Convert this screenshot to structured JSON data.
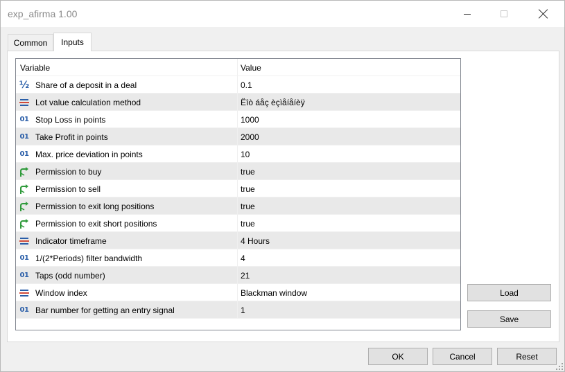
{
  "window": {
    "title": "exp_afirma 1.00"
  },
  "tabs": [
    {
      "label": "Common",
      "active": false
    },
    {
      "label": "Inputs",
      "active": true
    }
  ],
  "grid": {
    "headers": {
      "variable": "Variable",
      "value": "Value"
    },
    "rows": [
      {
        "icon": "fraction-icon",
        "variable": "Share of a deposit in a deal",
        "value": "0.1"
      },
      {
        "icon": "enum-list-icon",
        "variable": "Lot value calculation method",
        "value": "Ëîò áåç èçìåíåíèÿ"
      },
      {
        "icon": "integer-icon",
        "variable": "Stop Loss in points",
        "value": "1000"
      },
      {
        "icon": "integer-icon",
        "variable": "Take Profit in points",
        "value": "2000"
      },
      {
        "icon": "integer-icon",
        "variable": "Max. price deviation in points",
        "value": "10"
      },
      {
        "icon": "boolean-arrow-icon",
        "variable": "Permission to buy",
        "value": "true"
      },
      {
        "icon": "boolean-arrow-icon",
        "variable": "Permission to sell",
        "value": "true"
      },
      {
        "icon": "boolean-arrow-icon",
        "variable": "Permission to exit long positions",
        "value": "true"
      },
      {
        "icon": "boolean-arrow-icon",
        "variable": "Permission to exit short positions",
        "value": "true"
      },
      {
        "icon": "enum-list-icon",
        "variable": "Indicator timeframe",
        "value": "4 Hours"
      },
      {
        "icon": "integer-icon",
        "variable": "1/(2*Periods) filter bandwidth",
        "value": "4"
      },
      {
        "icon": "integer-icon",
        "variable": "Taps (odd number)",
        "value": "21"
      },
      {
        "icon": "enum-list-icon",
        "variable": "Window index",
        "value": "Blackman window"
      },
      {
        "icon": "integer-icon",
        "variable": "Bar number for getting an entry signal",
        "value": "1"
      }
    ]
  },
  "buttons": {
    "load": "Load",
    "save": "Save",
    "ok": "OK",
    "cancel": "Cancel",
    "reset": "Reset"
  },
  "icon_glyphs": {
    "integer": "01",
    "fraction": "½"
  },
  "colors": {
    "icon_blue": "#2a5ea8",
    "icon_green": "#2e9a3a",
    "enum_red": "#d04a3a",
    "row_alt": "#e9e9e9"
  }
}
